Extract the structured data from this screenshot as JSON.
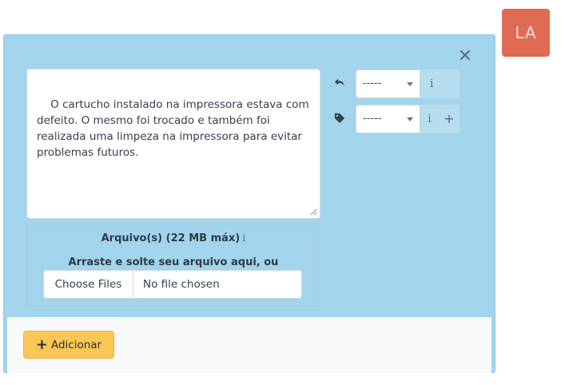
{
  "avatar": {
    "initials": "LA",
    "color": "#e06b55"
  },
  "panel": {
    "close_icon": "close-icon",
    "description_text": "O cartucho instalado na impressora estava com defeito. O mesmo foi trocado e também foi realizada uma limpeza na impressora para evitar problemas futuros.",
    "reply_select": {
      "icon": "reply-icon",
      "selected": "-----",
      "info_label": "i"
    },
    "tag_select": {
      "icon": "tag-icon",
      "selected": "-----",
      "info_label": "i",
      "add_label": "+"
    },
    "upload": {
      "title": "Arquivo(s) (22 MB máx)",
      "info_label": "i",
      "hint": "Arraste e solte seu arquivo aqui, ou",
      "choose_button": "Choose Files",
      "no_file": "No file chosen"
    },
    "footer": {
      "add_button": "Adicionar",
      "add_icon": "plus-icon"
    }
  },
  "colors": {
    "panel_bg": "#a2d5ec",
    "button_accent": "#fcc654",
    "info_link": "#3a77c7"
  }
}
